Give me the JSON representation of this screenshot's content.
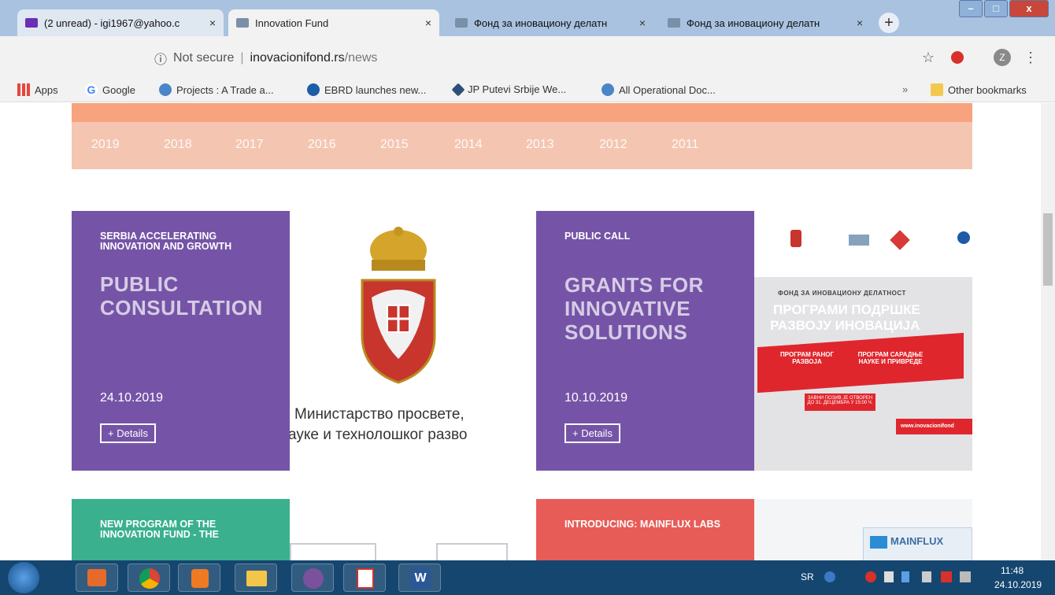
{
  "tabs": [
    {
      "label": "(2 unread) - igi1967@yahoo.c",
      "close": "×"
    },
    {
      "label": "Innovation Fund",
      "close": "×"
    },
    {
      "label": "Фонд за иновациону делатн",
      "close": "×"
    },
    {
      "label": "Фонд за иновациону делатн",
      "close": "×"
    }
  ],
  "new_tab": "+",
  "window": {
    "min": "–",
    "max": "□",
    "close": "x"
  },
  "address": {
    "back": "←",
    "forward": "→",
    "reload": "C",
    "home": "⌂",
    "info": "ⓘ",
    "not_secure": "Not secure",
    "sep": "|",
    "host": "inovacionifond.rs",
    "path": "/news",
    "star": "☆",
    "menu": "⋮",
    "profile": "Z"
  },
  "bookmarks": [
    {
      "label": "Apps"
    },
    {
      "label": "Google"
    },
    {
      "label": "Projects : A Trade a..."
    },
    {
      "label": "EBRD launches new..."
    },
    {
      "label": "JP Putevi Srbije We..."
    },
    {
      "label": "All Operational Doc..."
    }
  ],
  "bookmarks_more": "»",
  "other_bookmarks": "Other bookmarks",
  "years": [
    "2019",
    "2018",
    "2017",
    "2016",
    "2015",
    "2014",
    "2013",
    "2012",
    "2011"
  ],
  "cards": [
    {
      "kicker": "SERBIA ACCELERATING INNOVATION AND GROWTH",
      "headline": "PUBLIC CONSULTATION",
      "date": "24.10.2019",
      "button": "+ Details"
    },
    {
      "kicker": "PUBLIC CALL",
      "headline": "GRANTS FOR INNOVATIVE SOLUTIONS",
      "date": "10.10.2019",
      "button": "+ Details"
    },
    {
      "kicker": "NEW PROGRAM OF THE INNOVATION FUND - THE",
      "headline": "",
      "date": "",
      "button": ""
    },
    {
      "kicker": "INTRODUCING: MAINFLUX LABS",
      "headline": "",
      "date": "",
      "button": ""
    }
  ],
  "ministry_image": {
    "line1": "Министарство просвете,",
    "line2": "ауке и технолошког разво"
  },
  "fund_image": {
    "title_small": "ФОНД ЗА ИНОВАЦИОНУ ДЕЛАТНОСТ",
    "title1": "ПРОГРАМИ ПОДРШКЕ",
    "title2": "РАЗВОЈУ ИНОВАЦИЈА",
    "prog1": "ПРОГРАМ РАНОГ РАЗВОЈА",
    "prog2": "ПРОГРАМ САРАДЊЕ НАУКЕ И ПРИВРЕДЕ",
    "notice": "ЗАВНИ ПОЗИВ ЈЕ ОТВОРЕН ДО 31. ДЕЦЕМБРА У 15:00 Ч.",
    "url": "www.inovacionifond"
  },
  "mainflux_image": {
    "label": "MAINFLUX"
  },
  "taskbar": {
    "lang": "SR",
    "time": "11:48",
    "date": "24.10.2019"
  },
  "colors": {
    "purple": "#7554a7",
    "green": "#3ab08e",
    "red": "#e85c57",
    "peach": "#f4c6b1",
    "orange": "#f7a37d"
  }
}
